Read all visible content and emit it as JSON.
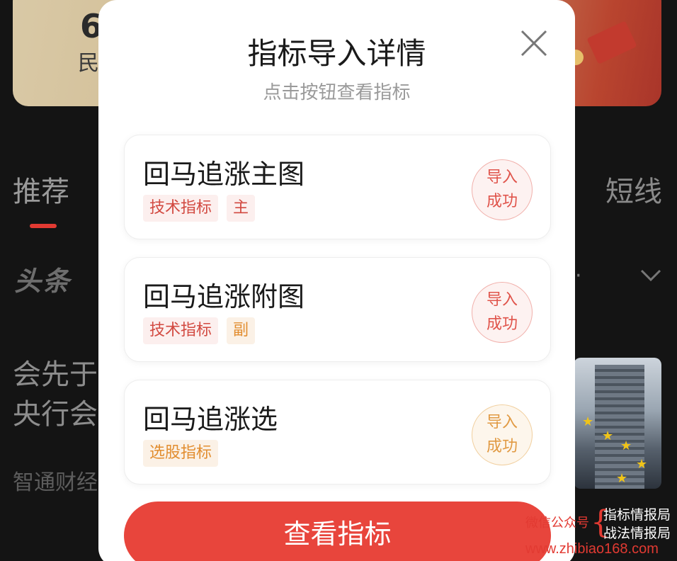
{
  "background": {
    "banner_number": "6",
    "banner_text": "民",
    "tab_left": "推荐",
    "tab_right": "短线",
    "logo": "头条",
    "dots": "·",
    "news_line1": "会先于",
    "news_line2": "央行会",
    "news_source": "智通财经"
  },
  "modal": {
    "title": "指标导入详情",
    "subtitle": "点击按钮查看指标",
    "items": [
      {
        "name": "回马追涨主图",
        "tags": [
          "技术指标",
          "主"
        ],
        "status_line1": "导入",
        "status_line2": "成功"
      },
      {
        "name": "回马追涨附图",
        "tags": [
          "技术指标",
          "副"
        ],
        "status_line1": "导入",
        "status_line2": "成功"
      },
      {
        "name": "回马追涨选",
        "tags": [
          "选股指标"
        ],
        "status_line1": "导入",
        "status_line2": "成功"
      }
    ],
    "button_label": "查看指标"
  },
  "watermark": {
    "left": "微信公众号",
    "brace": "{",
    "right_line1": "指标情报局",
    "right_line2": "战法情报局",
    "url": "www.zhibiao168.com"
  },
  "colors": {
    "accent_red": "#e8453c",
    "tag_orange": "#e28d2f",
    "status_red": "#e0544b",
    "status_orange": "#e19a43"
  }
}
